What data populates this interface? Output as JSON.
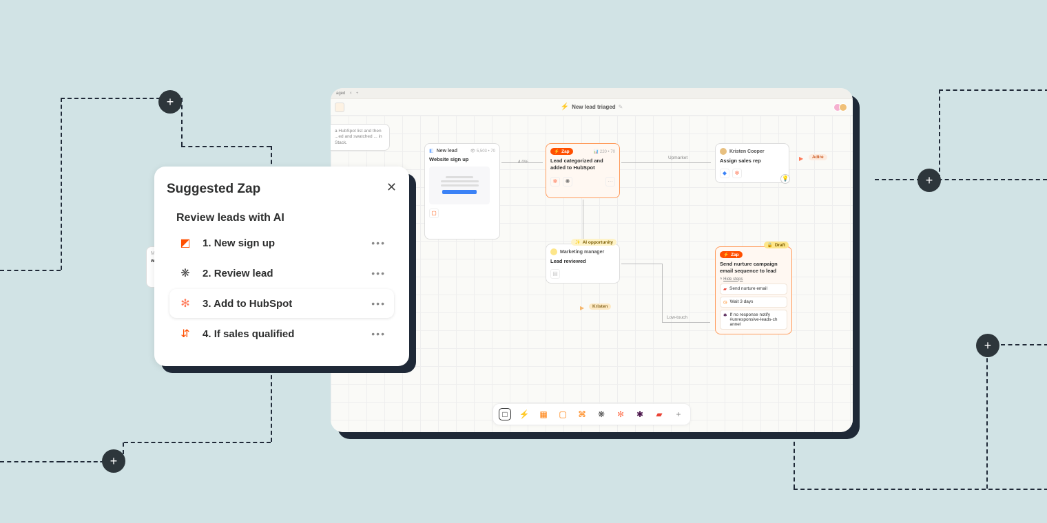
{
  "popover": {
    "title": "Suggested Zap",
    "subtitle": "Review leads with AI",
    "steps": [
      {
        "num": "1.",
        "label": "New sign up",
        "icon": "interfaces"
      },
      {
        "num": "2.",
        "label": "Review lead",
        "icon": "openai"
      },
      {
        "num": "3.",
        "label": "Add to HubSpot",
        "icon": "hubspot"
      },
      {
        "num": "4.",
        "label": "If sales qualified",
        "icon": "branch"
      }
    ]
  },
  "peek_card": {
    "role": "Marketing manager",
    "title": "w lead"
  },
  "window": {
    "tab": "aged",
    "title": "New lead triaged",
    "avatars": [
      "#f5b0d0",
      "#f0c078"
    ]
  },
  "canvas": {
    "note": "a HubSpot list and then\n...ed and swatched\n... in Stack.",
    "node_new_lead": {
      "badge": "New lead",
      "metric": "5,503 • 70",
      "title": "Website sign up"
    },
    "node_zap1": {
      "badge": "Zap",
      "metric": "220 • 70",
      "title": "Lead categorized and added to HubSpot"
    },
    "node_assign": {
      "person": "Kristen Cooper",
      "title": "Assign sales rep"
    },
    "tag_adire": "Adire",
    "node_marketing": {
      "role": "Marketing manager",
      "title": "Lead reviewed",
      "ai_badge": "AI opportunity"
    },
    "tag_kristen": "Kristen",
    "node_draft": {
      "badge": "Zap",
      "draft": "Draft",
      "title": "Send nurture campaign email sequence to lead",
      "toggle": "Hide steps",
      "substeps": [
        {
          "icon": "gmail",
          "text": "Send nurture email"
        },
        {
          "icon": "clock",
          "text": "Wait 3 days"
        },
        {
          "icon": "slack",
          "text": "If no response notify #unresponsive-leads-ch annel"
        }
      ]
    },
    "labels": {
      "conv": "4.0%",
      "up": "Upmarket",
      "low": "Low-touch"
    },
    "toolbar_icons": [
      "square",
      "bolt",
      "table",
      "interfaces",
      "chatbot",
      "openai",
      "hubspot",
      "slack",
      "gmail",
      "plus"
    ]
  }
}
